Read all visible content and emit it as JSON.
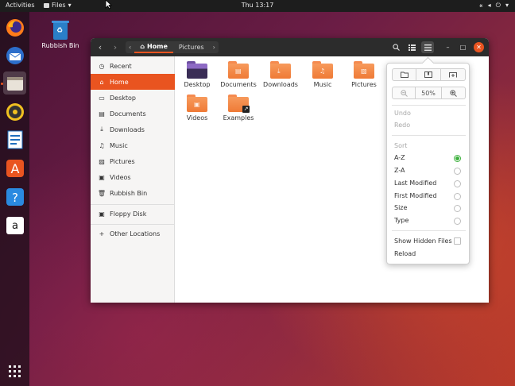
{
  "topbar": {
    "activities": "Activities",
    "app_menu": "Files",
    "clock": "Thu 13:17",
    "tray_icons": [
      "network-icon",
      "volume-icon",
      "power-icon"
    ]
  },
  "dock": {
    "apps": [
      "firefox-icon",
      "thunderbird-icon",
      "files-icon",
      "rhythmbox-icon",
      "libreoffice-writer-icon",
      "software-center-icon",
      "help-icon",
      "amazon-icon"
    ],
    "show_apps_icon": "grid-icon"
  },
  "desktop": {
    "icons": [
      {
        "label": "Rubbish Bin"
      }
    ]
  },
  "window": {
    "path": [
      "Home",
      "Pictures"
    ],
    "sidebar": [
      {
        "label": "Recent"
      },
      {
        "label": "Home"
      },
      {
        "label": "Desktop"
      },
      {
        "label": "Documents"
      },
      {
        "label": "Downloads"
      },
      {
        "label": "Music"
      },
      {
        "label": "Pictures"
      },
      {
        "label": "Videos"
      },
      {
        "label": "Rubbish Bin"
      },
      {
        "label": "Floppy Disk"
      },
      {
        "label": "Other Locations"
      }
    ],
    "files": [
      {
        "label": "Desktop"
      },
      {
        "label": "Documents"
      },
      {
        "label": "Downloads"
      },
      {
        "label": "Music"
      },
      {
        "label": "Pictures"
      },
      {
        "label": "Videos"
      },
      {
        "label": "Examples"
      }
    ]
  },
  "menu": {
    "zoom": "50%",
    "undo": "Undo",
    "redo": "Redo",
    "sort_header": "Sort",
    "sort_options": [
      {
        "label": "A-Z",
        "selected": true
      },
      {
        "label": "Z-A",
        "selected": false
      },
      {
        "label": "Last Modified",
        "selected": false
      },
      {
        "label": "First Modified",
        "selected": false
      },
      {
        "label": "Size",
        "selected": false
      },
      {
        "label": "Type",
        "selected": false
      }
    ],
    "show_hidden": "Show Hidden Files",
    "reload": "Reload"
  },
  "colors": {
    "accent": "#e95420",
    "radio_on": "#3eb13e"
  }
}
